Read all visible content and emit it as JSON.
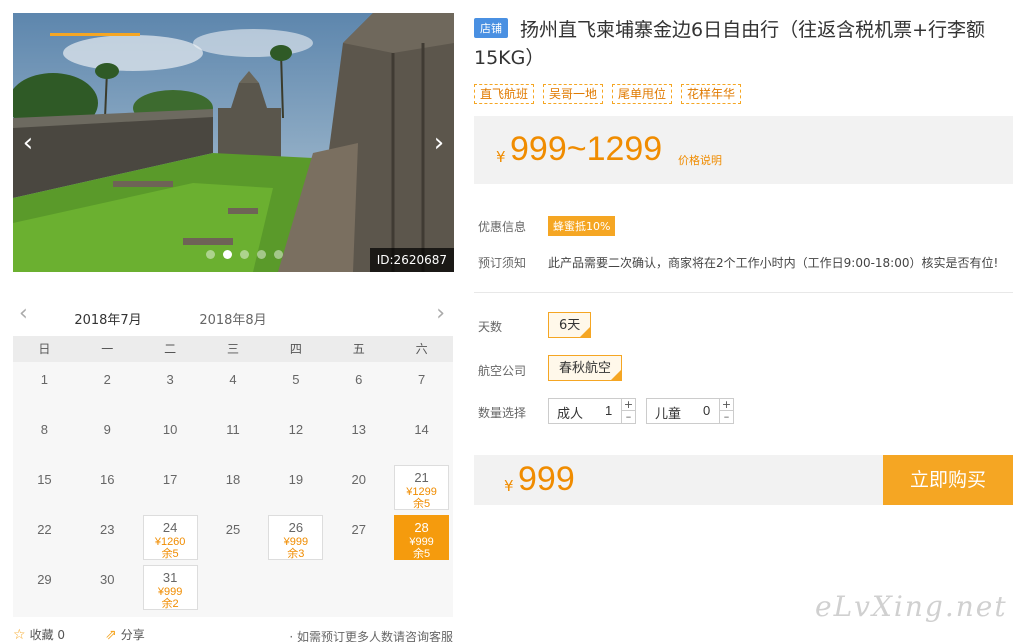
{
  "gallery": {
    "prev_icon": "‹",
    "next_icon": "›",
    "image_id": "ID:2620687",
    "slide_count": 5,
    "active_slide": 1
  },
  "calendar": {
    "prev_icon": "‹",
    "next_icon": "›",
    "months": [
      "2018年7月",
      "2018年8月"
    ],
    "active_month": 0,
    "weekdays": [
      "日",
      "一",
      "二",
      "三",
      "四",
      "五",
      "六"
    ],
    "days": [
      {
        "d": "1"
      },
      {
        "d": "2"
      },
      {
        "d": "3"
      },
      {
        "d": "4"
      },
      {
        "d": "5"
      },
      {
        "d": "6"
      },
      {
        "d": "7"
      },
      {
        "d": "8"
      },
      {
        "d": "9"
      },
      {
        "d": "10"
      },
      {
        "d": "11"
      },
      {
        "d": "12"
      },
      {
        "d": "13"
      },
      {
        "d": "14"
      },
      {
        "d": "15"
      },
      {
        "d": "16"
      },
      {
        "d": "17"
      },
      {
        "d": "18"
      },
      {
        "d": "19"
      },
      {
        "d": "20"
      },
      {
        "d": "21",
        "price": "¥1299",
        "stock": "余5"
      },
      {
        "d": "22"
      },
      {
        "d": "23"
      },
      {
        "d": "24",
        "price": "¥1260",
        "stock": "余5"
      },
      {
        "d": "25"
      },
      {
        "d": "26",
        "price": "¥999",
        "stock": "余3"
      },
      {
        "d": "27"
      },
      {
        "d": "28",
        "price": "¥999",
        "stock": "余5",
        "selected": true
      },
      {
        "d": "29"
      },
      {
        "d": "30"
      },
      {
        "d": "31",
        "price": "¥999",
        "stock": "余2"
      }
    ]
  },
  "footer": {
    "favorite_label": "收藏",
    "favorite_count": "0",
    "share_label": "分享",
    "note": "· 如需预订更多人数请咨询客服"
  },
  "product": {
    "shop_badge": "店铺",
    "title": "扬州直飞柬埔寨金边6日自由行（往返含税机票+行李额15KG）",
    "tags": [
      "直飞航班",
      "吴哥一地",
      "尾单甩位",
      "花样年华"
    ],
    "price_symbol": "¥",
    "price_range": "999~1299",
    "price_explain": "价格说明",
    "discount_label": "优惠信息",
    "discount_value": "蜂蜜抵10%",
    "notice_label": "预订须知",
    "notice_text": "此产品需要二次确认，商家将在2个工作小时内（工作日9:00-18:00）核实是否有位!",
    "days_label": "天数",
    "days_value": "6天",
    "airline_label": "航空公司",
    "airline_value": "春秋航空",
    "qty_label": "数量选择",
    "adult_label": "成人",
    "adult_value": "1",
    "child_label": "儿童",
    "child_value": "0",
    "plus": "+",
    "minus": "–",
    "total_symbol": "¥",
    "total": "999",
    "buy_label": "立即购买"
  },
  "watermark": "eLvXing.net",
  "colors": {
    "accent": "#f5a623",
    "price": "#f08c00",
    "badge": "#4a90e2"
  }
}
